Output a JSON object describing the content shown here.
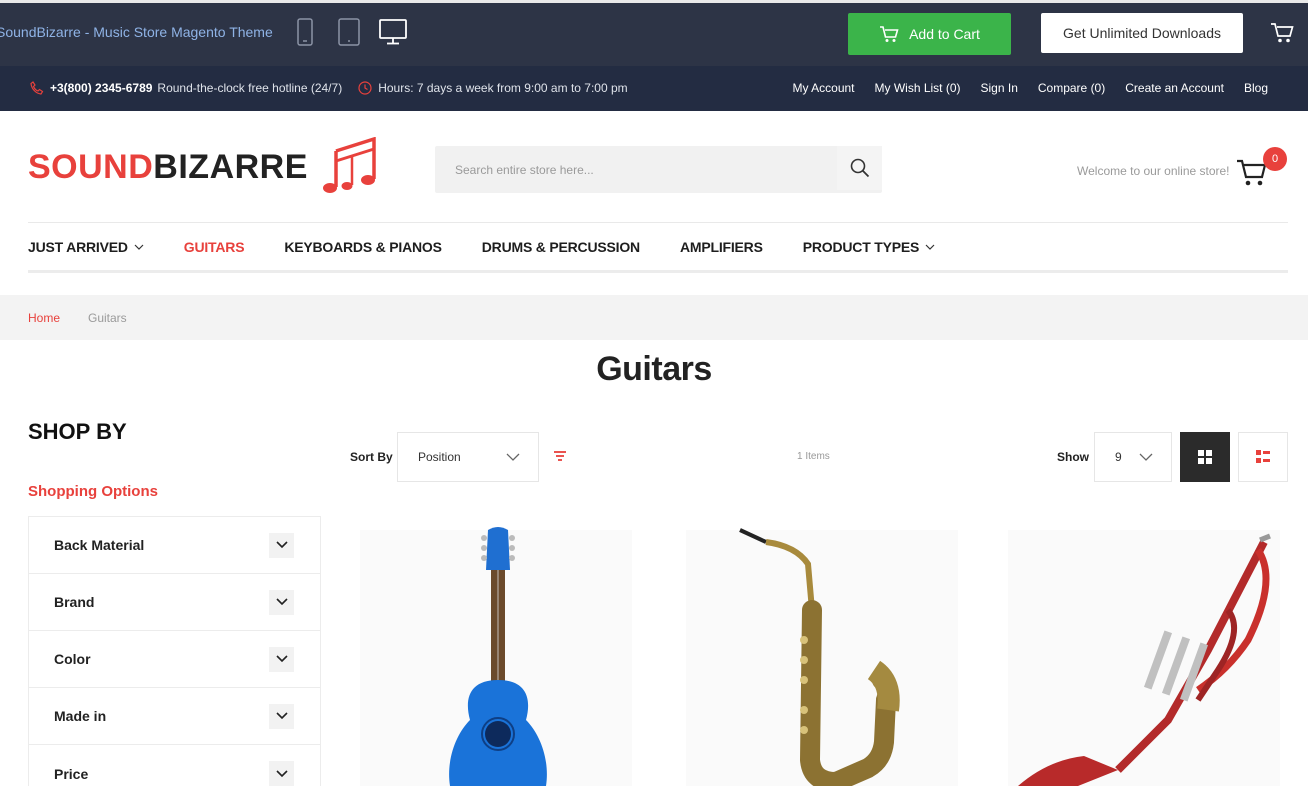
{
  "demo_bar": {
    "title": "SoundBizarre - Music Store Magento Theme",
    "add_to_cart": "Add to Cart",
    "unlimited": "Get Unlimited Downloads"
  },
  "info_bar": {
    "phone": "+3(800) 2345-6789",
    "hotline": "Round-the-clock free hotline (24/7)",
    "hours": "Hours: 7 days a week from 9:00 am to 7:00 pm",
    "links": [
      "My Account",
      "My Wish List (0)",
      "Sign In",
      "Compare (0)",
      "Create an Account",
      "Blog"
    ]
  },
  "header": {
    "logo_part1": "SOUND",
    "logo_part2": "BIZARRE",
    "search_placeholder": "Search entire store here...",
    "welcome": "Welcome to our online store!",
    "cart_count": "0"
  },
  "nav": {
    "items": [
      "JUST ARRIVED",
      "GUITARS",
      "KEYBOARDS & PIANOS",
      "DRUMS & PERCUSSION",
      "AMPLIFIERS",
      "PRODUCT TYPES"
    ]
  },
  "breadcrumbs": {
    "home": "Home",
    "current": "Guitars"
  },
  "page_title": "Guitars",
  "sidebar": {
    "shop_by": "SHOP BY",
    "shopping_options": "Shopping Options",
    "filters": [
      "Back Material",
      "Brand",
      "Color",
      "Made in",
      "Price"
    ]
  },
  "toolbar": {
    "sort_label": "Sort By",
    "sort_value": "Position",
    "items_count": "1 Items",
    "show_label": "Show",
    "limit_value": "9"
  },
  "colors": {
    "accent": "#e8413c",
    "green": "#3bb44a",
    "dark_bar": "#2d3446",
    "info_bar": "#232c42"
  },
  "icons": {
    "devices": [
      "mobile-icon",
      "tablet-icon",
      "desktop-icon"
    ],
    "products": [
      "acoustic-guitar-image",
      "saxophone-image",
      "trumpet-image"
    ]
  }
}
